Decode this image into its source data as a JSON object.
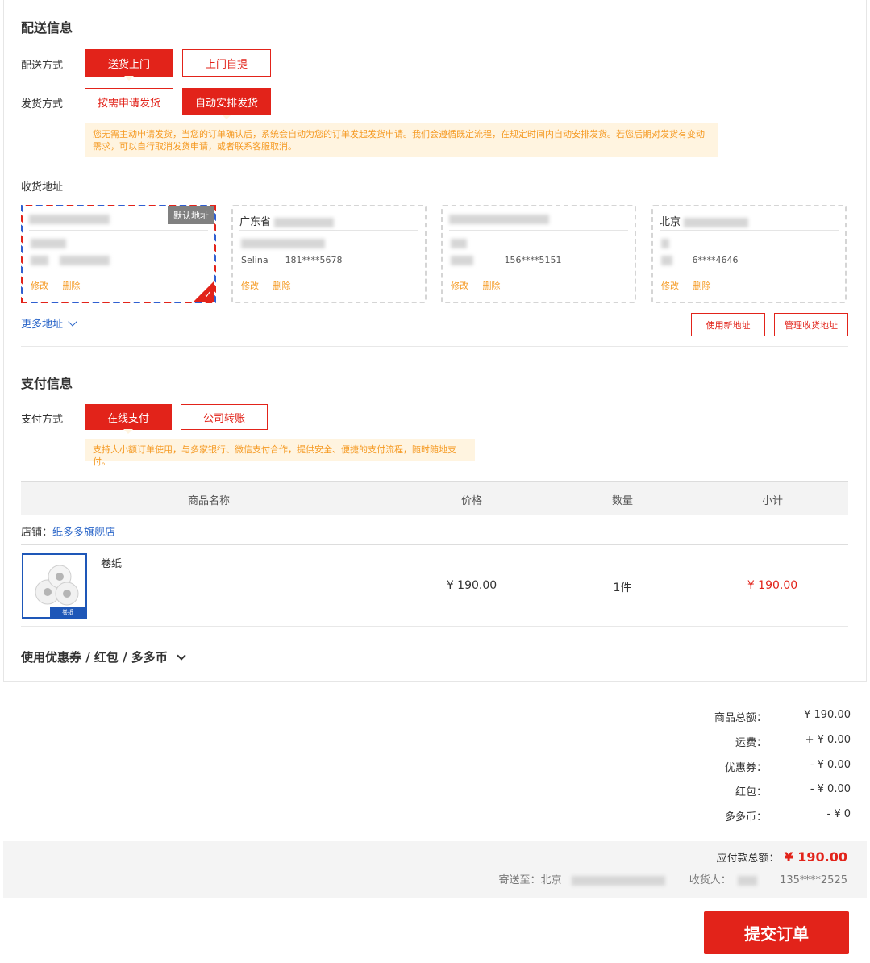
{
  "delivery": {
    "title": "配送信息",
    "method_label": "配送方式",
    "method_options": [
      "送货上门",
      "上门自提"
    ],
    "ship_label": "发货方式",
    "ship_options": [
      "按需申请发货",
      "自动安排发货"
    ],
    "ship_tip": "您无需主动申请发货，当您的订单确认后，系统会自动为您的订单发起发货申请。我们会遵循既定流程，在规定时间内自动安排发货。若您后期对发货有变动需求，可以自行取消发货申请，或者联系客服取消。"
  },
  "address": {
    "title": "收货地址",
    "default_badge": "默认地址",
    "edit": "修改",
    "delete": "删除",
    "cards": [
      {
        "head": "",
        "phone": ""
      },
      {
        "head": "广东省",
        "name": "Selina",
        "phone": "181****5678"
      },
      {
        "head": "",
        "phone": "156****5151"
      },
      {
        "head": "北京",
        "phone": "6****4646"
      }
    ],
    "more": "更多地址",
    "new_address": "使用新地址",
    "manage": "管理收货地址"
  },
  "payment": {
    "title": "支付信息",
    "method_label": "支付方式",
    "options": [
      "在线支付",
      "公司转账"
    ],
    "tip": "支持大小额订单使用，与多家银行、微信支付合作，提供安全、便捷的支付流程，随时随地支付。"
  },
  "table": {
    "headers": [
      "商品名称",
      "价格",
      "数量",
      "小计"
    ],
    "shop_label": "店铺：",
    "shop_name": "纸多多旗舰店",
    "item": {
      "name": "卷纸",
      "price": "¥ 190.00",
      "qty": "1件",
      "subtotal": "¥ 190.00",
      "img_tag": "卷纸"
    }
  },
  "coupon": {
    "label": "使用优惠券 / 红包 / 多多币"
  },
  "summary": [
    {
      "k": "商品总额：",
      "v": "¥ 190.00"
    },
    {
      "k": "运费：",
      "v": "+ ¥ 0.00"
    },
    {
      "k": "优惠券：",
      "v": "- ¥ 0.00"
    },
    {
      "k": "红包：",
      "v": "- ¥ 0.00"
    },
    {
      "k": "多多币：",
      "v": "- ¥ 0"
    }
  ],
  "total": {
    "label": "应付款总额：",
    "amount": "¥ 190.00",
    "ship_to_label": "寄送至：",
    "ship_to_city": "北京",
    "receiver_label": "收货人：",
    "receiver_phone": "135****2525"
  },
  "submit": "提交订单",
  "colors": {
    "accent": "#e2231a",
    "link": "#2864c8",
    "tip_text": "#f59a23",
    "tip_bg": "#fff4e0"
  }
}
